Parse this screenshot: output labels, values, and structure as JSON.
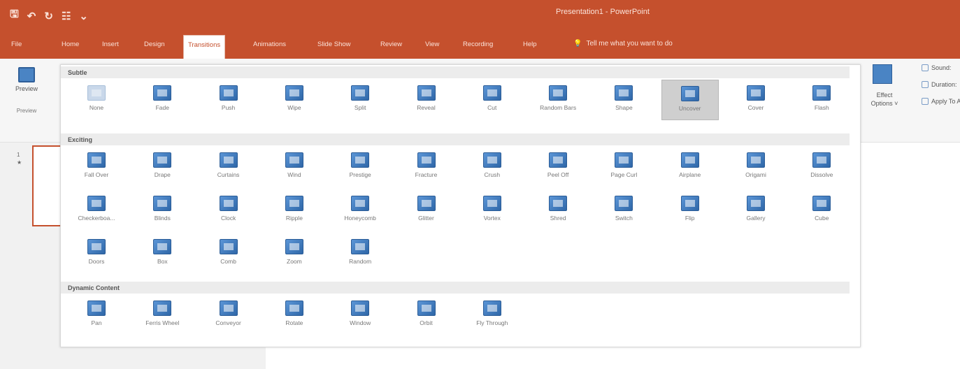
{
  "qat": [
    "🖫",
    "↶",
    "↻",
    "☷",
    "⌄"
  ],
  "app": {
    "doc_title": "Presentation1 - PowerPoint"
  },
  "tabs": [
    "File",
    "Home",
    "Insert",
    "Design",
    "Transitions",
    "Animations",
    "Slide Show",
    "Review",
    "View",
    "Recording",
    "Help"
  ],
  "tell_me": "Tell me what you want to do",
  "preview": {
    "label": "Preview",
    "group": "Preview"
  },
  "slide_pane": {
    "slide_number": "1",
    "star": "★"
  },
  "sections": {
    "subtle": {
      "title": "Subtle",
      "items": [
        "None",
        "Fade",
        "Push",
        "Wipe",
        "Split",
        "Reveal",
        "Cut",
        "Random Bars",
        "Shape",
        "Uncover",
        "Cover",
        "Flash"
      ]
    },
    "exciting": {
      "title": "Exciting",
      "items": [
        "Fall Over",
        "Drape",
        "Curtains",
        "Wind",
        "Prestige",
        "Fracture",
        "Crush",
        "Peel Off",
        "Page Curl",
        "Airplane",
        "Origami",
        "Dissolve",
        "Checkerboa...",
        "Blinds",
        "Clock",
        "Ripple",
        "Honeycomb",
        "Glitter",
        "Vortex",
        "Shred",
        "Switch",
        "Flip",
        "Gallery",
        "Cube",
        "Doors",
        "Box",
        "Comb",
        "Zoom",
        "Random"
      ]
    },
    "dynamic": {
      "title": "Dynamic Content",
      "items": [
        "Pan",
        "Ferris Wheel",
        "Conveyor",
        "Rotate",
        "Window",
        "Orbit",
        "Fly Through"
      ]
    }
  },
  "effect_options": {
    "line1": "Effect",
    "line2": "Options ˅"
  },
  "timing": [
    "Sound:",
    "Duration:",
    "Apply To All"
  ],
  "colors": {
    "accent": "#c5502d",
    "icon_blue": "#4a84c4"
  }
}
